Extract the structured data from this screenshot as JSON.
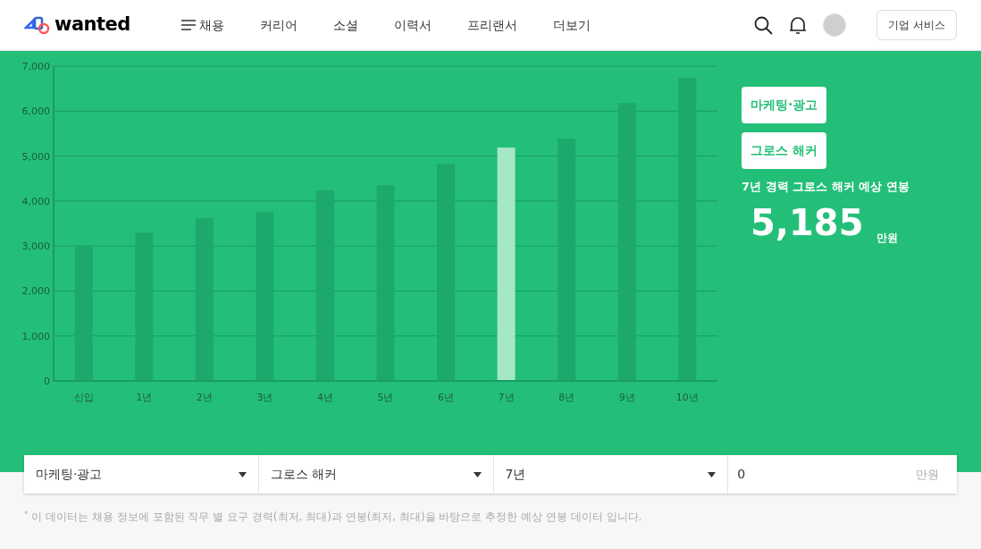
{
  "header": {
    "logo": "wanted",
    "nav": [
      {
        "label": "채용",
        "kind": "menu"
      },
      {
        "label": "커리어",
        "kind": "link"
      },
      {
        "label": "소셜",
        "kind": "link"
      },
      {
        "label": "이력서",
        "kind": "link"
      },
      {
        "label": "프리랜서",
        "kind": "link"
      },
      {
        "label": "더보기",
        "kind": "link"
      }
    ],
    "business_button": "기업 서비스"
  },
  "salary_chart": {
    "chart_data": {
      "type": "bar",
      "stacked": true,
      "grid": true,
      "categories": [
        "신입",
        "1년",
        "2년",
        "3년",
        "4년",
        "5년",
        "6년",
        "7년",
        "8년",
        "9년",
        "10년"
      ],
      "series": [
        {
          "color": "#1ca96b",
          "values": [
            2980,
            3300,
            3620,
            3760,
            4240,
            4350,
            4830,
            null,
            5390,
            6180,
            6740
          ]
        },
        {
          "color": "#a6e7c6",
          "values": [
            null,
            null,
            null,
            null,
            null,
            null,
            null,
            5190,
            null,
            null,
            null
          ]
        }
      ],
      "ylim": [
        0,
        7000
      ],
      "yticks": [
        {
          "value": 0,
          "label": "0"
        },
        {
          "value": 1000,
          "label": "1,000"
        },
        {
          "value": 2000,
          "label": "2,000"
        },
        {
          "value": 3000,
          "label": "3,000"
        },
        {
          "value": 4000,
          "label": "4,000"
        },
        {
          "value": 5000,
          "label": "5,000"
        },
        {
          "value": 6000,
          "label": "6,000"
        },
        {
          "value": 7000,
          "label": "7,000"
        }
      ]
    }
  },
  "summary": {
    "tags": [
      "마케팅·광고",
      "그로스 해커"
    ],
    "caption": "7년 경력 그로스 해커 예상 연봉",
    "amount": "5,185",
    "unit": "만원"
  },
  "filters": [
    {
      "kind": "select",
      "value": "마케팅·광고"
    },
    {
      "kind": "select",
      "value": "그로스 해커"
    },
    {
      "kind": "select",
      "value": "7년"
    },
    {
      "kind": "input",
      "value": "0",
      "unit": "만원"
    }
  ],
  "footnote": {
    "mark": "*",
    "text": "이 데이터는 채용 정보에 포함된 직무 별 요구 경력(최저, 최대)과 연봉(최저, 최대)을 바탕으로 추정한 예상 연봉 데이터 입니다."
  }
}
